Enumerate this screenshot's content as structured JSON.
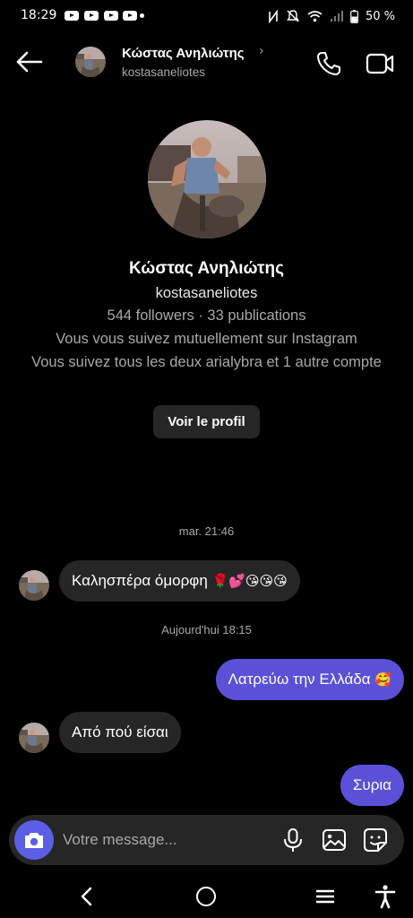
{
  "status_bar": {
    "time": "18:29",
    "battery": "50 %"
  },
  "header": {
    "name": "Κώστας Ανηλιώτης",
    "chevron": "›",
    "username": "kostasaneliotes"
  },
  "profile": {
    "name": "Κώστας Ανηλιώτης",
    "username": "kostasaneliotes",
    "stats": "544 followers · 33 publications",
    "mutual": "Vous vous suivez mutuellement sur Instagram",
    "followed_by": "Vous suivez tous les deux arialybra et 1 autre compte",
    "view_profile_label": "Voir le profil"
  },
  "chat": {
    "timestamp_1": "mar. 21:46",
    "message_1": "Καλησπέρα όμορφη",
    "message_1_emoji": "🌹💕😘😘😘",
    "timestamp_2": "Aujourd'hui 18:15",
    "message_2": "Λατρεύω την Ελλάδα",
    "message_2_emoji": "🥰",
    "message_3": "Από πού είσαι",
    "message_4": "Συρια"
  },
  "composer": {
    "placeholder": "Votre message..."
  },
  "colors": {
    "accent": "#5b51d8",
    "bubble_in": "#262626",
    "background": "#000000"
  },
  "icons": [
    "back-arrow-icon",
    "phone-icon",
    "video-camera-icon",
    "camera-icon",
    "microphone-icon",
    "gallery-icon",
    "sticker-icon",
    "youtube-icon",
    "wifi-icon",
    "battery-icon"
  ]
}
